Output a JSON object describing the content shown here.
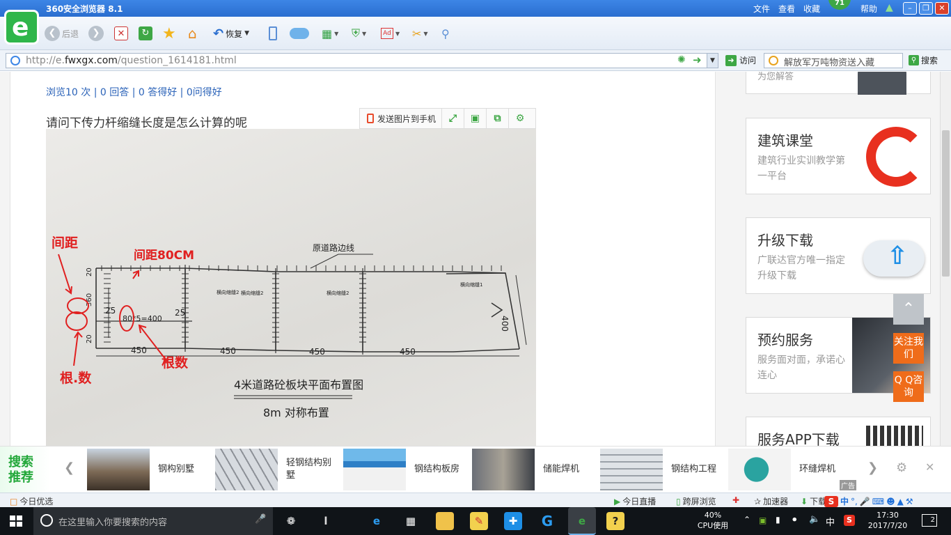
{
  "browser": {
    "title": "360安全浏览器 8.1",
    "menus": [
      "文件",
      "查看",
      "收藏",
      "帮助"
    ],
    "badge": "71",
    "logo_letter": "e"
  },
  "toolbar": {
    "back": "后退",
    "restore": "恢复"
  },
  "address": {
    "url_prefix": "http://e.",
    "url_host": "fwxgx.com",
    "url_path": "/question_1614181.html",
    "visit": "访问",
    "search_placeholder": "解放军万吨物资送入藏",
    "search_btn": "搜索"
  },
  "question": {
    "stats": "浏览10 次 | 0 回答 | 0 答得好 | 0问得好",
    "title": "请问下传力杆缩缝长度是怎么计算的呢"
  },
  "image_tools": {
    "send": "发送图片到手机"
  },
  "photo": {
    "annot_spacing": "间距",
    "annot_spacing80": "间距80CM",
    "annot_count1": "根.数",
    "annot_count2": "根数",
    "road_edge": "原道路边线",
    "calc": "80*5=400",
    "plan_title": "4米道路砼板块平面布置图",
    "plan_sub": "8m 对称布置",
    "dim_450": "450",
    "dim_400": "400",
    "dim_25": "25",
    "dim_20": "20",
    "dim_360": "360",
    "joint1": "横向缩缝1",
    "joint2": "横向缩缝2"
  },
  "sidebar": {
    "top_fragment": "为您解答",
    "cards": [
      {
        "title": "建筑课堂",
        "desc": "建筑行业实训教学第一平台"
      },
      {
        "title": "升级下载",
        "desc": "广联达官方唯一指定升级下载"
      },
      {
        "title": "预约服务",
        "desc": "服务面对面，承诺心连心"
      },
      {
        "title": "服务APP下载",
        "desc": ""
      }
    ],
    "follow": "关注我们",
    "qq": "Q Q咨询"
  },
  "recommend": {
    "label": "搜索推荐",
    "items": [
      "钢构别墅",
      "轻钢结构别墅",
      "钢结构板房",
      "储能焊机",
      "钢结构工程",
      "环缝焊机"
    ],
    "ad": "广告"
  },
  "statusbar": {
    "left": "今日优选",
    "live": "今日直播",
    "cross": "跨屏浏览",
    "accel": "加速器",
    "download": "下载",
    "ime": "中"
  },
  "taskbar": {
    "search": "在这里输入你要搜索的内容",
    "cpu_pct": "40%",
    "cpu_label": "CPU使用",
    "ime": "中",
    "time": "17:30",
    "date": "2017/7/20",
    "notif": "2"
  },
  "colors": {
    "accent_green": "#3ea745",
    "link_blue": "#2a62b8",
    "titlebar_blue": "#2a6ecf",
    "annot_red": "#e02020",
    "orange": "#ef6c1a"
  }
}
